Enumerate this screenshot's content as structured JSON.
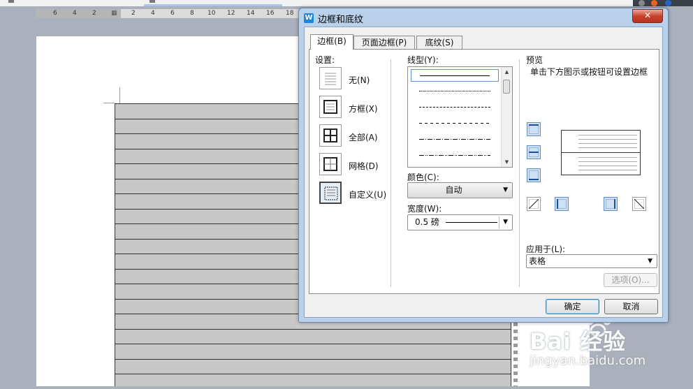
{
  "ruler": {
    "ticks": [
      "6",
      "4",
      "2",
      "2",
      "4",
      "6",
      "8",
      "10",
      "12",
      "14",
      "16",
      "18"
    ]
  },
  "dialog": {
    "title": "边框和底纹",
    "app_icon": "W",
    "close_label": "✕",
    "tabs": [
      {
        "label": "边框(B)",
        "active": true
      },
      {
        "label": "页面边框(P)",
        "active": false
      },
      {
        "label": "底纹(S)",
        "active": false
      }
    ],
    "settings": {
      "heading": "设置:",
      "options": [
        {
          "label": "无(N)",
          "icon": "border-none-icon"
        },
        {
          "label": "方框(X)",
          "icon": "border-box-icon"
        },
        {
          "label": "全部(A)",
          "icon": "border-all-icon"
        },
        {
          "label": "网格(D)",
          "icon": "border-grid-icon"
        },
        {
          "label": "自定义(U)",
          "icon": "border-custom-icon",
          "selected": true
        }
      ]
    },
    "line_style": {
      "heading": "线型(Y):",
      "options": [
        "solid",
        "dotted",
        "dashed-small",
        "dashed",
        "dash-dot",
        "dash-dot-dot"
      ],
      "selected_index": 0
    },
    "color": {
      "heading": "颜色(C):",
      "value": "自动"
    },
    "width": {
      "heading": "宽度(W):",
      "value": "0.5  磅"
    },
    "preview": {
      "heading": "预览",
      "hint": "单击下方图示或按钮可设置边框"
    },
    "apply_to": {
      "heading": "应用于(L):",
      "value": "表格"
    },
    "options_button": "选项(O)...",
    "ok_button": "确定",
    "cancel_button": "取消"
  },
  "watermark": {
    "logo": "Bai 经验",
    "url": "jingyan.baidu.com"
  },
  "colors": {
    "dialog_frame": "#b9d1ea",
    "close_red": "#c7432f",
    "table_fill": "#c8c8c8"
  }
}
